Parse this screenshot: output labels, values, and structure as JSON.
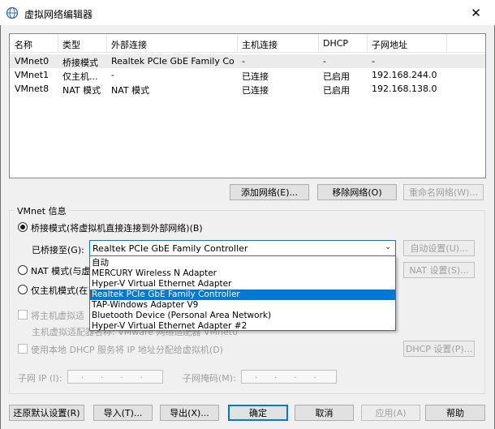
{
  "window": {
    "title": "虚拟网络编辑器",
    "close_glyph": "✕"
  },
  "table": {
    "columns": [
      "名称",
      "类型",
      "外部连接",
      "主机连接",
      "DHCP",
      "子网地址"
    ],
    "rows": [
      [
        "VMnet0",
        "桥接模式",
        "Realtek PCIe GbE Family Co...",
        "-",
        "-",
        "-"
      ],
      [
        "VMnet1",
        "仅主机...",
        "-",
        "已连接",
        "已启用",
        "192.168.244.0"
      ],
      [
        "VMnet8",
        "NAT 模式",
        "NAT 模式",
        "已连接",
        "已启用",
        "192.168.138.0"
      ]
    ]
  },
  "network_buttons": {
    "add": "添加网络(E)...",
    "remove": "移除网络(O)",
    "rename": "重命名网络(W)..."
  },
  "vmnet_info": {
    "group_label": "VMnet 信息",
    "bridged_label": "桥接模式(将虚拟机直接连接到外部网络)(B)",
    "bridged_to_label": "已桥接至(G):",
    "bridged_to_value": "Realtek PCIe GbE Family Controller",
    "auto_settings": "自动设置(U)...",
    "nat_label": "NAT 模式(与虚",
    "nat_settings": "NAT 设置(S)...",
    "hostonly_label": "仅主机模式(在",
    "connect_host_label": "将主机虚拟适",
    "host_adapter_name": "主机虚拟适配器名称: VMware 网络适配器 VMnet0",
    "dhcp_label": "使用本地 DHCP 服务将 IP 地址分配给虚拟机(D)",
    "dhcp_settings": "DHCP 设置(P)...",
    "subnet_ip_label": "子网 IP (I):",
    "subnet_mask_label": "子网掩码(M):",
    "ip_dots": "...."
  },
  "dropdown": {
    "options": [
      "自动",
      "MERCURY Wireless N Adapter",
      "Hyper-V Virtual Ethernet Adapter",
      "Realtek PCIe GbE Family Controller",
      "TAP-Windows Adapter V9",
      "Bluetooth Device (Personal Area Network)",
      "Hyper-V Virtual Ethernet Adapter #2"
    ],
    "selected_index": 3
  },
  "footer": {
    "restore": "还原默认设置(R)",
    "import": "导入(T)...",
    "export": "导出(X)...",
    "ok": "确定",
    "cancel": "取消",
    "apply": "应用(A)",
    "help": "帮助"
  },
  "colors": {
    "accent": "#0078d7",
    "disabled_text": "#a0a0a0"
  }
}
